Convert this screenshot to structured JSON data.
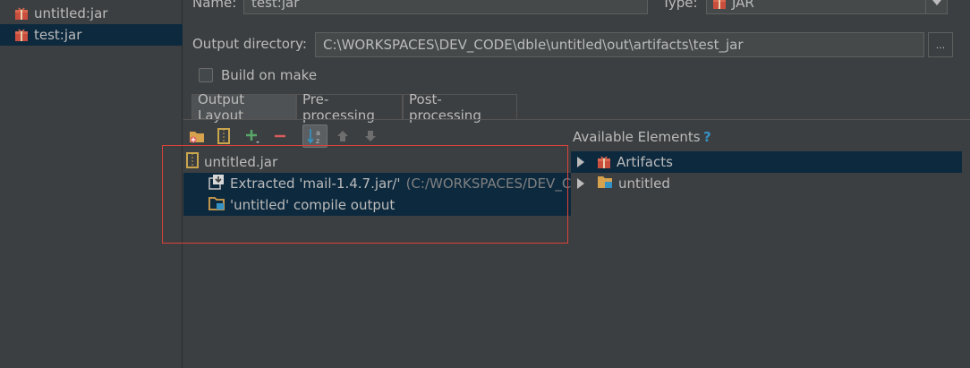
{
  "left_list": {
    "items": [
      {
        "label": "untitled:jar",
        "selected": false
      },
      {
        "label": "test:jar",
        "selected": true
      }
    ]
  },
  "settings": {
    "name_label": "Name:",
    "name_value": "test:jar",
    "type_label": "Type:",
    "type_value": "JAR",
    "output_dir_label": "Output directory:",
    "output_dir_value": "C:\\WORKSPACES\\DEV_CODE\\dble\\untitled\\out\\artifacts\\test_jar",
    "browse_label": "...",
    "build_on_make_label": "Build on make",
    "build_on_make_checked": false
  },
  "tabs": [
    {
      "label": "Output Layout",
      "active": true
    },
    {
      "label": "Pre-processing",
      "active": false
    },
    {
      "label": "Post-processing",
      "active": false
    }
  ],
  "toolbar": {
    "icons": [
      "new-folder-icon",
      "archive-icon",
      "add-icon",
      "remove-icon",
      "sort-az-icon",
      "move-up-icon",
      "move-down-icon"
    ],
    "sort_pressed": true
  },
  "layout_tree": {
    "root": "untitled.jar",
    "children": [
      {
        "label": "Extracted 'mail-1.4.7.jar/'",
        "detail": "(C:/WORKSPACES/DEV_COD"
      },
      {
        "label": "'untitled' compile output",
        "detail": ""
      }
    ]
  },
  "available": {
    "title": "Available Elements",
    "help": "?",
    "items": [
      {
        "label": "Artifacts",
        "selected": true
      },
      {
        "label": "untitled",
        "selected": false
      }
    ]
  },
  "colors": {
    "background": "#3c3f41",
    "selection": "#0d293e",
    "highlight_border": "#d9433a",
    "add_green": "#59a869",
    "remove_red": "#db5c5c",
    "help_blue": "#3592c4"
  }
}
